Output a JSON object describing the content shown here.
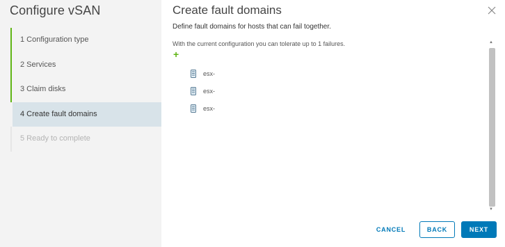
{
  "wizard": {
    "title": "Configure vSAN",
    "steps": [
      {
        "label": "1 Configuration type",
        "state": "done"
      },
      {
        "label": "2 Services",
        "state": "done"
      },
      {
        "label": "3 Claim disks",
        "state": "done"
      },
      {
        "label": "4 Create fault domains",
        "state": "active"
      },
      {
        "label": "5 Ready to complete",
        "state": "disabled"
      }
    ]
  },
  "page": {
    "title": "Create fault domains",
    "subtitle": "Define fault domains for hosts that can fail together.",
    "info": "With the current configuration you can tolerate up to 1 failures.",
    "add_symbol": "+",
    "hosts": [
      {
        "name": "esx-",
        "icon": "host-server-icon"
      },
      {
        "name": "esx-",
        "icon": "host-server-icon"
      },
      {
        "name": "esx-",
        "icon": "host-server-icon"
      }
    ]
  },
  "footer": {
    "cancel_label": "CANCEL",
    "back_label": "BACK",
    "next_label": "NEXT"
  },
  "colors": {
    "accent": "#0079b8",
    "done": "#60b515",
    "active_bg": "#d8e3e9",
    "sidebar_bg": "#f3f3f3"
  }
}
